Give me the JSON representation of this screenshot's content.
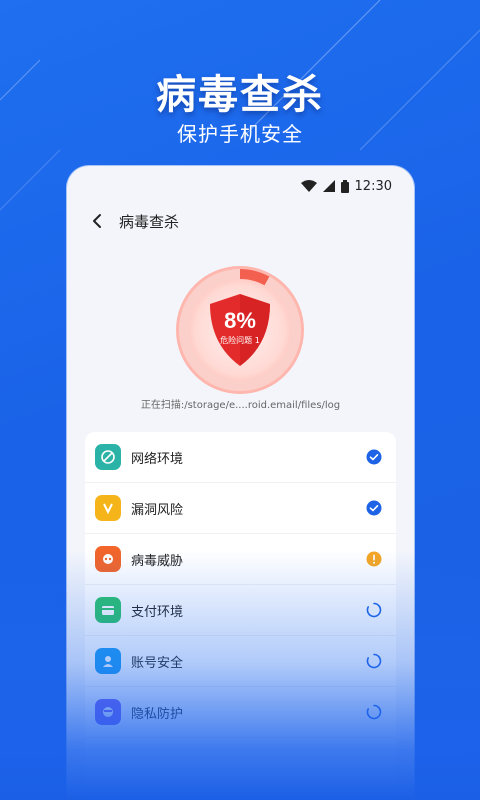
{
  "hero": {
    "title": "病毒查杀",
    "subtitle": "保护手机安全"
  },
  "status_bar": {
    "time": "12:30",
    "icons": [
      "wifi-icon",
      "signal-icon",
      "battery-icon"
    ]
  },
  "nav": {
    "back_icon": "chevron-left-icon",
    "title": "病毒查杀"
  },
  "scan": {
    "percent_text": "8%",
    "progress_fraction": 0.08,
    "risk_label": "危险问题 1",
    "path_text": "正在扫描:/storage/e....roid.email/files/log"
  },
  "checks": [
    {
      "label": "网络环境",
      "icon": "network-icon",
      "icon_color": "#2ab3a6",
      "status": "done"
    },
    {
      "label": "漏洞风险",
      "icon": "vulnerability-icon",
      "icon_color": "#f5b51a",
      "status": "done"
    },
    {
      "label": "病毒威胁",
      "icon": "virus-icon",
      "icon_color": "#f2652b",
      "status": "warning"
    },
    {
      "label": "支付环境",
      "icon": "payment-icon",
      "icon_color": "#2cc36b",
      "status": "loading"
    },
    {
      "label": "账号安全",
      "icon": "account-icon",
      "icon_color": "#1e9bf0",
      "status": "loading"
    },
    {
      "label": "隐私防护",
      "icon": "privacy-icon",
      "icon_color": "#7a5cf0",
      "status": "loading"
    }
  ],
  "colors": {
    "brand_blue": "#1f6ff0",
    "done": "#1e63e6",
    "warning": "#f5a623",
    "danger": "#e32b2b"
  }
}
